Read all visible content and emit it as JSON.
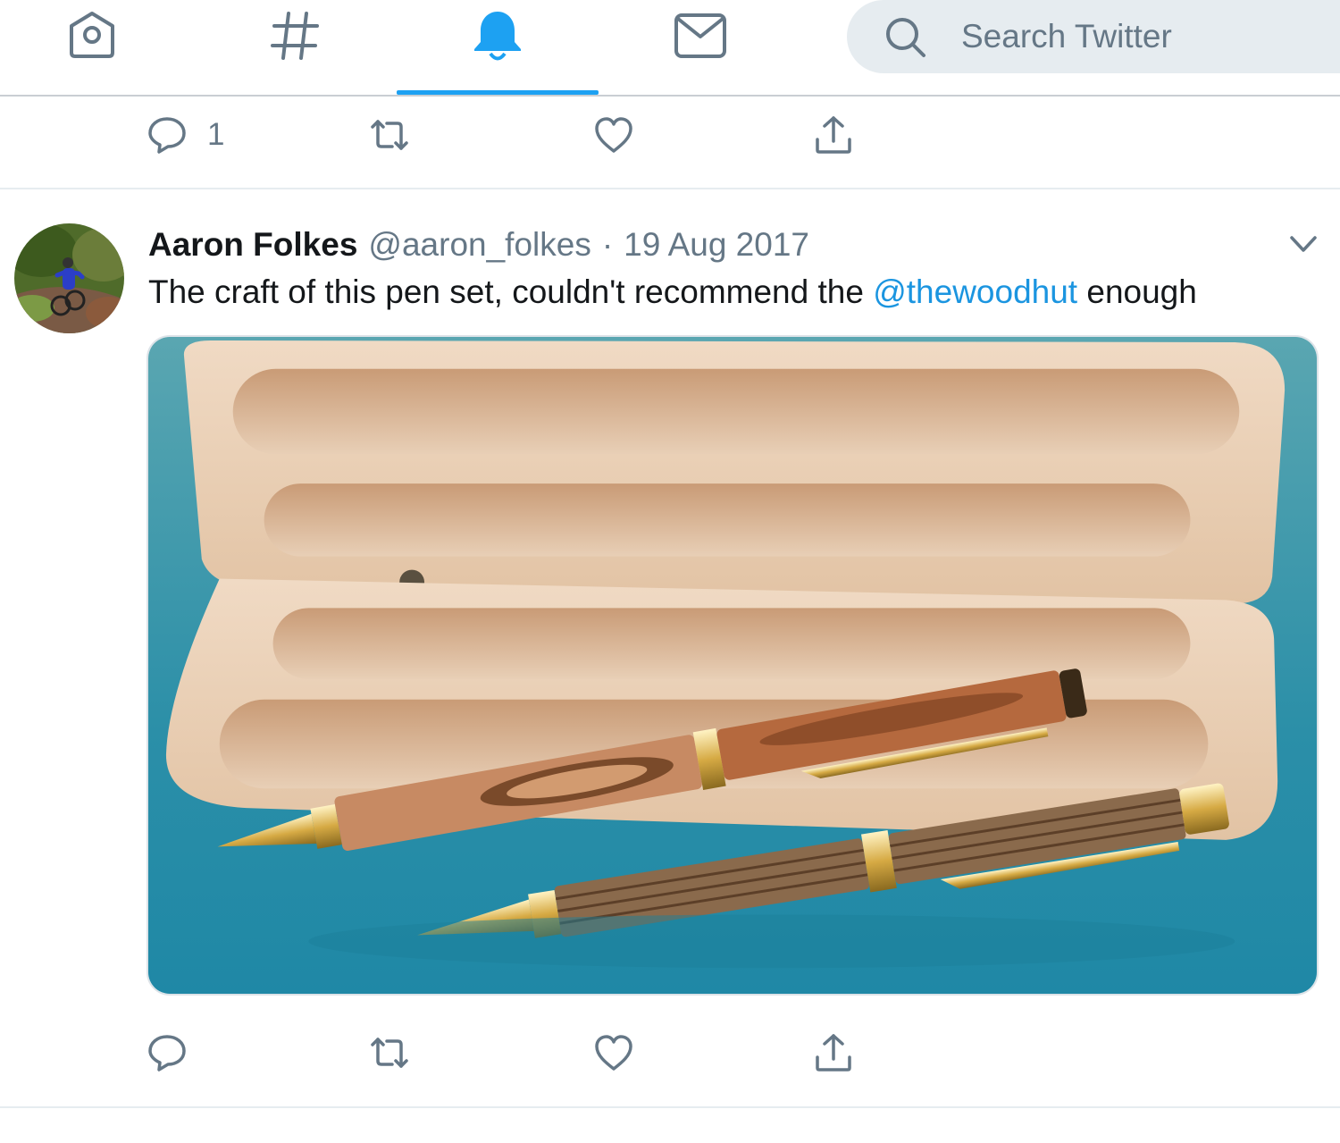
{
  "nav": {
    "tabs": [
      {
        "icon": "home-icon",
        "active": false
      },
      {
        "icon": "explore-hash-icon",
        "active": false
      },
      {
        "icon": "notifications-bell-icon",
        "active": true
      },
      {
        "icon": "messages-envelope-icon",
        "active": false
      }
    ],
    "search_placeholder": "Search Twitter"
  },
  "colors": {
    "accent": "#1da1f2",
    "mention": "#1b95e0",
    "secondary_text": "#657786",
    "icon_gray": "#657786"
  },
  "previous_tweet": {
    "actions": {
      "reply_count": "1"
    }
  },
  "tweet": {
    "author_name": "Aaron Folkes",
    "author_handle": "@aaron_folkes",
    "separator": "·",
    "date": "19 Aug 2017",
    "text_before": "The craft of this pen set, couldn't recommend the ",
    "mention": "@thewoodhut",
    "text_after": " enough",
    "media_alt": "Two wooden pens with gold fittings in an open wooden pen case on a teal surface"
  }
}
